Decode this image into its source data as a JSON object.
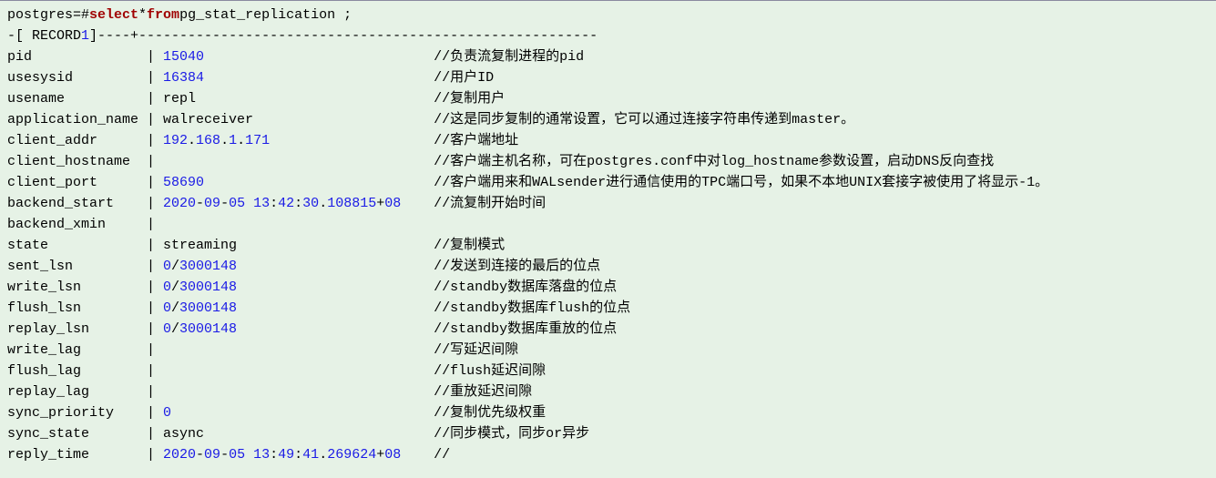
{
  "prompt": {
    "prefix": "postgres=# ",
    "kw_select": "select",
    "star": " * ",
    "kw_from": "from",
    "table": " pg_stat_replication ;"
  },
  "record_header": {
    "left": "-[ RECORD ",
    "num": "1",
    "right": " ]----+"
  },
  "rows": [
    {
      "field": "pid",
      "value_parts": [
        {
          "t": "num",
          "v": "15040"
        }
      ],
      "comment": "//负责流复制进程的pid"
    },
    {
      "field": "usesysid",
      "value_parts": [
        {
          "t": "num",
          "v": "16384"
        }
      ],
      "comment": "//用户ID"
    },
    {
      "field": "usename",
      "value_parts": [
        {
          "t": "plain",
          "v": "repl"
        }
      ],
      "comment": "//复制用户"
    },
    {
      "field": "application_name",
      "value_parts": [
        {
          "t": "plain",
          "v": "walreceiver"
        }
      ],
      "comment": "//这是同步复制的通常设置，它可以通过连接字符串传递到master。"
    },
    {
      "field": "client_addr",
      "value_parts": [
        {
          "t": "num",
          "v": "192"
        },
        {
          "t": "plain",
          "v": "."
        },
        {
          "t": "num",
          "v": "168"
        },
        {
          "t": "plain",
          "v": "."
        },
        {
          "t": "num",
          "v": "1"
        },
        {
          "t": "plain",
          "v": "."
        },
        {
          "t": "num",
          "v": "171"
        }
      ],
      "comment": "//客户端地址"
    },
    {
      "field": "client_hostname",
      "value_parts": [],
      "comment": "//客户端主机名称，可在postgres.conf中对log_hostname参数设置，启动DNS反向查找"
    },
    {
      "field": "client_port",
      "value_parts": [
        {
          "t": "num",
          "v": "58690"
        }
      ],
      "comment": "//客户端用来和WALsender进行通信使用的TPC端口号，如果不本地UNIX套接字被使用了将显示-1。"
    },
    {
      "field": "backend_start",
      "value_parts": [
        {
          "t": "num",
          "v": "2020"
        },
        {
          "t": "plain",
          "v": "-"
        },
        {
          "t": "num",
          "v": "09"
        },
        {
          "t": "plain",
          "v": "-"
        },
        {
          "t": "num",
          "v": "05"
        },
        {
          "t": "plain",
          "v": " "
        },
        {
          "t": "num",
          "v": "13"
        },
        {
          "t": "plain",
          "v": ":"
        },
        {
          "t": "num",
          "v": "42"
        },
        {
          "t": "plain",
          "v": ":"
        },
        {
          "t": "num",
          "v": "30"
        },
        {
          "t": "plain",
          "v": "."
        },
        {
          "t": "num",
          "v": "108815"
        },
        {
          "t": "plain",
          "v": "+"
        },
        {
          "t": "num",
          "v": "08"
        }
      ],
      "comment": "    //流复制开始时间"
    },
    {
      "field": "backend_xmin",
      "value_parts": [],
      "comment": ""
    },
    {
      "field": "state",
      "value_parts": [
        {
          "t": "plain",
          "v": "streaming"
        }
      ],
      "comment": "//复制模式"
    },
    {
      "field": "sent_lsn",
      "value_parts": [
        {
          "t": "num",
          "v": "0"
        },
        {
          "t": "plain",
          "v": "/"
        },
        {
          "t": "num",
          "v": "3000148"
        }
      ],
      "comment": "//发送到连接的最后的位点"
    },
    {
      "field": "write_lsn",
      "value_parts": [
        {
          "t": "num",
          "v": "0"
        },
        {
          "t": "plain",
          "v": "/"
        },
        {
          "t": "num",
          "v": "3000148"
        }
      ],
      "comment": "//standby数据库落盘的位点"
    },
    {
      "field": "flush_lsn",
      "value_parts": [
        {
          "t": "num",
          "v": "0"
        },
        {
          "t": "plain",
          "v": "/"
        },
        {
          "t": "num",
          "v": "3000148"
        }
      ],
      "comment": "//standby数据库flush的位点"
    },
    {
      "field": "replay_lsn",
      "value_parts": [
        {
          "t": "num",
          "v": "0"
        },
        {
          "t": "plain",
          "v": "/"
        },
        {
          "t": "num",
          "v": "3000148"
        }
      ],
      "comment": "//standby数据库重放的位点"
    },
    {
      "field": "write_lag",
      "value_parts": [],
      "comment": "//写延迟间隙"
    },
    {
      "field": "flush_lag",
      "value_parts": [],
      "comment": "//flush延迟间隙"
    },
    {
      "field": "replay_lag",
      "value_parts": [],
      "comment": "//重放延迟间隙"
    },
    {
      "field": "sync_priority",
      "value_parts": [
        {
          "t": "num",
          "v": "0"
        }
      ],
      "comment": "//复制优先级权重"
    },
    {
      "field": "sync_state",
      "value_parts": [
        {
          "t": "plain",
          "v": "async"
        }
      ],
      "comment": "//同步模式，同步or异步"
    },
    {
      "field": "reply_time",
      "value_parts": [
        {
          "t": "num",
          "v": "2020"
        },
        {
          "t": "plain",
          "v": "-"
        },
        {
          "t": "num",
          "v": "09"
        },
        {
          "t": "plain",
          "v": "-"
        },
        {
          "t": "num",
          "v": "05"
        },
        {
          "t": "plain",
          "v": " "
        },
        {
          "t": "num",
          "v": "13"
        },
        {
          "t": "plain",
          "v": ":"
        },
        {
          "t": "num",
          "v": "49"
        },
        {
          "t": "plain",
          "v": ":"
        },
        {
          "t": "num",
          "v": "41"
        },
        {
          "t": "plain",
          "v": "."
        },
        {
          "t": "num",
          "v": "269624"
        },
        {
          "t": "plain",
          "v": "+"
        },
        {
          "t": "num",
          "v": "08"
        }
      ],
      "comment": "    //"
    }
  ],
  "sep": "| ",
  "dash_fill": "--------------------------------------------------------"
}
